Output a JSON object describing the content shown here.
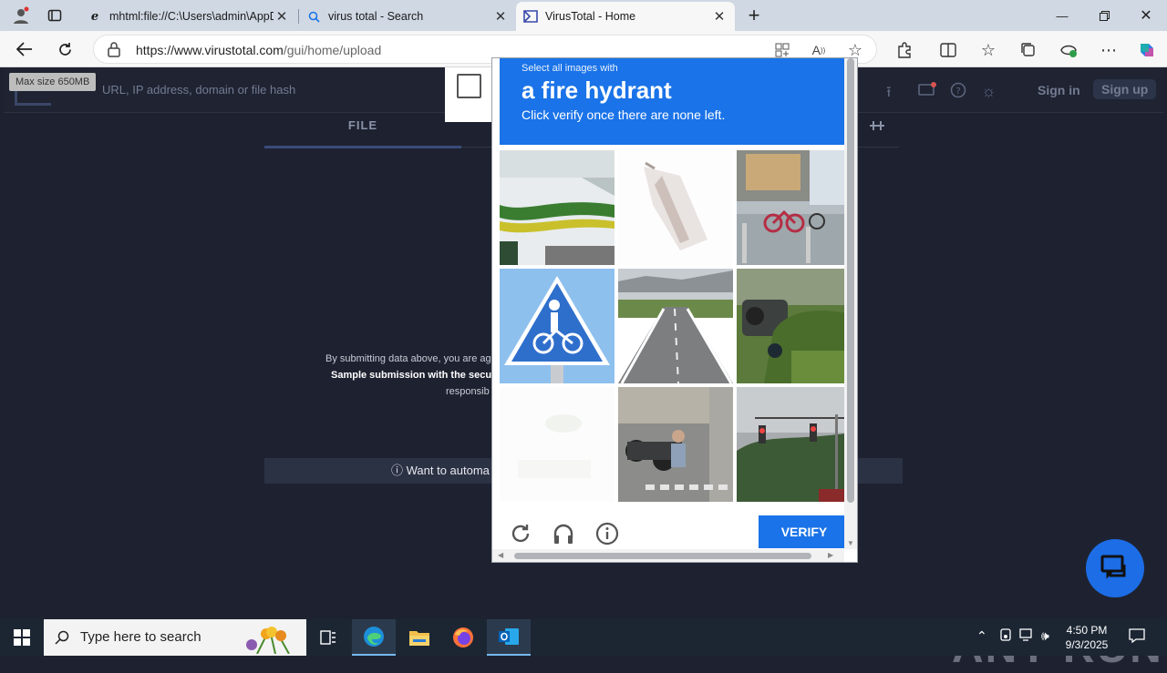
{
  "browser": {
    "tabs": [
      {
        "title": "mhtml:file://C:\\Users\\admin\\AppData",
        "icon": "ie-icon",
        "active": false
      },
      {
        "title": "virus total - Search",
        "icon": "search-icon",
        "active": false
      },
      {
        "title": "VirusTotal - Home",
        "icon": "virustotal-icon",
        "active": true
      }
    ],
    "url_host": "https://www.virustotal.com",
    "url_path": "/gui/home/upload",
    "window_controls": [
      "minimize",
      "restore",
      "close"
    ]
  },
  "virustotal": {
    "search_placeholder": "URL, IP address, domain or file hash",
    "tooltip": "Max size 650MB",
    "sign_in": "Sign in",
    "sign_up": "Sign up",
    "tab_file": "FILE",
    "terms_line1": "By submitting data above, you are ag",
    "terms_line2": "Sample submission with the secu",
    "terms_line3": "responsib",
    "automate": "Want to automa"
  },
  "captcha": {
    "instruction_small": "Select all images with",
    "target": "a fire hydrant",
    "instruction_sub": "Click verify once there are none left.",
    "verify_label": "VERIFY",
    "tiles": [
      "bus-tile",
      "fragment-tile",
      "bicycles-shop-tile",
      "crosswalk-sign-tile",
      "highway-tile",
      "jeep-plants-tile",
      "faded-tile",
      "motorcycles-tile",
      "traffic-light-tile"
    ]
  },
  "watermark": "ANY RUN",
  "taskbar": {
    "search_placeholder": "Type here to search",
    "time": "4:50 PM",
    "date": "9/3/2025"
  },
  "colors": {
    "captcha_blue": "#1a73e8",
    "vt_bg": "#1e2230",
    "taskbar": "#1c2633"
  }
}
